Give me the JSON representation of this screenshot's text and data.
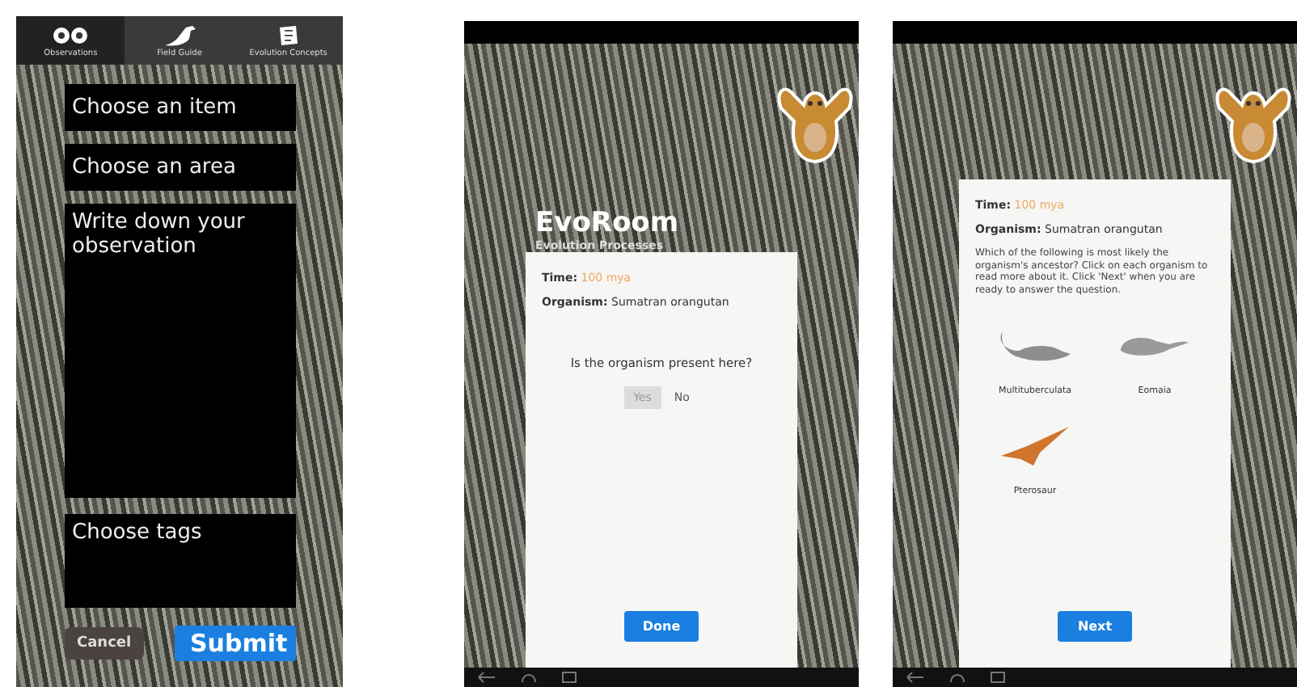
{
  "observation_form": {
    "tabs": [
      {
        "label": "Observations",
        "kind": "eyes",
        "selected": true
      },
      {
        "label": "Field Guide",
        "kind": "bird",
        "selected": false
      },
      {
        "label": "Evolution Concepts",
        "kind": "book",
        "selected": false
      }
    ],
    "fields": [
      {
        "placeholder": "Choose an item",
        "kind": "select"
      },
      {
        "placeholder": "Choose an area",
        "kind": "select"
      },
      {
        "placeholder": "Write down your observation",
        "kind": "textarea"
      },
      {
        "placeholder": "Choose tags",
        "kind": "tags"
      }
    ],
    "buttons": [
      {
        "label": "Cancel",
        "kind": "secondary"
      },
      {
        "label": "Submit",
        "kind": "primary"
      }
    ]
  },
  "presence_screen": {
    "app_title": "EvoRoom",
    "app_subtitle": "Evolution Processes",
    "time_label": "Time:",
    "time_value": "100 mya",
    "organism_label": "Organism:",
    "organism_value": "Sumatran orangutan",
    "question": "Is the organism present here?",
    "choices": [
      {
        "label": "Yes",
        "selected": true
      },
      {
        "label": "No",
        "selected": false
      }
    ],
    "button": "Done"
  },
  "ancestor_screen": {
    "time_label": "Time:",
    "time_value": "100 mya",
    "organism_label": "Organism:",
    "organism_value": "Sumatran orangutan",
    "instructions": "Which of the following is most likely the organism's ancestor? Click on each organism to read more about it. Click 'Next' when you are ready to answer the question.",
    "organisms": [
      {
        "label": "Multituberculata",
        "kind": "long-tail"
      },
      {
        "label": "Eomaia",
        "kind": "small"
      },
      {
        "label": "Pterosaur",
        "kind": "flying"
      }
    ],
    "button": "Next"
  }
}
